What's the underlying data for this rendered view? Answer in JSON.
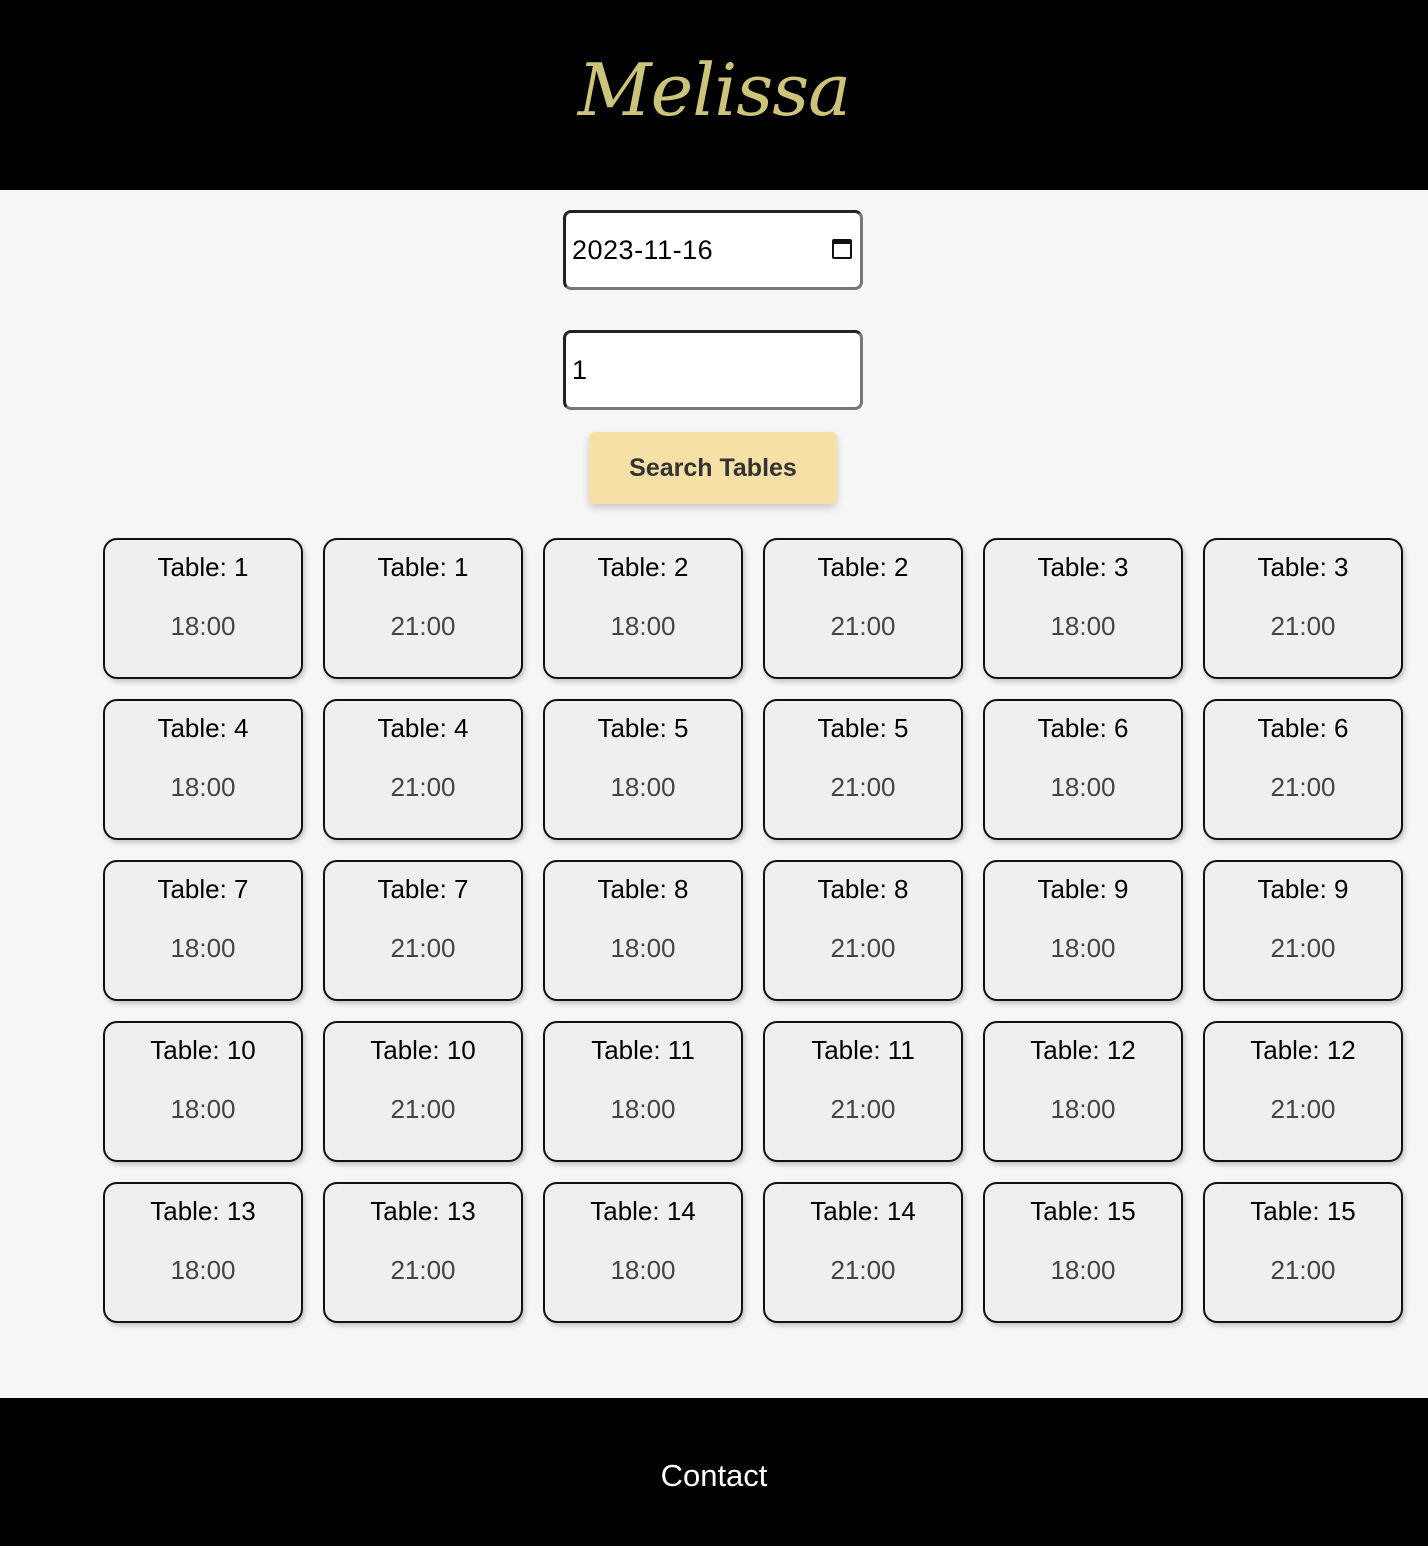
{
  "header": {
    "logo_text": "Melissa"
  },
  "search": {
    "date_value": "2023-11-16",
    "guests_value": "1",
    "button_label": "Search Tables"
  },
  "tables": [
    {
      "label": "Table: 1",
      "time": "18:00"
    },
    {
      "label": "Table: 1",
      "time": "21:00"
    },
    {
      "label": "Table: 2",
      "time": "18:00"
    },
    {
      "label": "Table: 2",
      "time": "21:00"
    },
    {
      "label": "Table: 3",
      "time": "18:00"
    },
    {
      "label": "Table: 3",
      "time": "21:00"
    },
    {
      "label": "Table: 4",
      "time": "18:00"
    },
    {
      "label": "Table: 4",
      "time": "21:00"
    },
    {
      "label": "Table: 5",
      "time": "18:00"
    },
    {
      "label": "Table: 5",
      "time": "21:00"
    },
    {
      "label": "Table: 6",
      "time": "18:00"
    },
    {
      "label": "Table: 6",
      "time": "21:00"
    },
    {
      "label": "Table: 7",
      "time": "18:00"
    },
    {
      "label": "Table: 7",
      "time": "21:00"
    },
    {
      "label": "Table: 8",
      "time": "18:00"
    },
    {
      "label": "Table: 8",
      "time": "21:00"
    },
    {
      "label": "Table: 9",
      "time": "18:00"
    },
    {
      "label": "Table: 9",
      "time": "21:00"
    },
    {
      "label": "Table: 10",
      "time": "18:00"
    },
    {
      "label": "Table: 10",
      "time": "21:00"
    },
    {
      "label": "Table: 11",
      "time": "18:00"
    },
    {
      "label": "Table: 11",
      "time": "21:00"
    },
    {
      "label": "Table: 12",
      "time": "18:00"
    },
    {
      "label": "Table: 12",
      "time": "21:00"
    },
    {
      "label": "Table: 13",
      "time": "18:00"
    },
    {
      "label": "Table: 13",
      "time": "21:00"
    },
    {
      "label": "Table: 14",
      "time": "18:00"
    },
    {
      "label": "Table: 14",
      "time": "21:00"
    },
    {
      "label": "Table: 15",
      "time": "18:00"
    },
    {
      "label": "Table: 15",
      "time": "21:00"
    }
  ],
  "footer": {
    "contact_label": "Contact"
  },
  "colors": {
    "header_bg": "#000000",
    "logo": "#cbc47a",
    "button_bg": "#f7e0a6",
    "card_bg": "#efefef"
  }
}
